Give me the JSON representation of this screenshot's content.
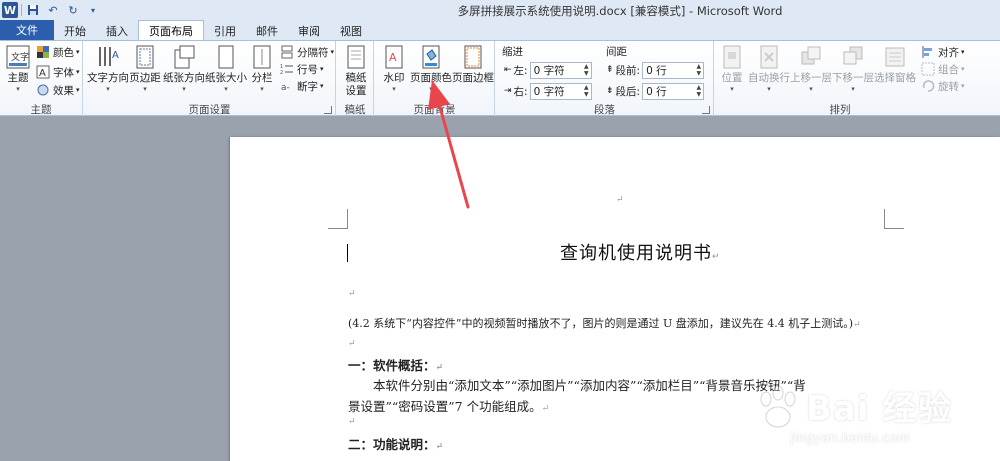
{
  "window": {
    "title": "多屏拼接展示系统使用说明.docx [兼容模式] - Microsoft Word",
    "app_icon": "W"
  },
  "tabs": [
    {
      "label": "文件"
    },
    {
      "label": "开始"
    },
    {
      "label": "插入"
    },
    {
      "label": "页面布局"
    },
    {
      "label": "引用"
    },
    {
      "label": "邮件"
    },
    {
      "label": "审阅"
    },
    {
      "label": "视图"
    }
  ],
  "ribbon": {
    "theme_group": {
      "label": "主题",
      "themes_btn": "主题",
      "colors": "颜色",
      "fonts": "字体",
      "effects": "效果"
    },
    "page_setup": {
      "label": "页面设置",
      "text_direction": "文字方向",
      "margins": "页边距",
      "orientation": "纸张方向",
      "size": "纸张大小",
      "columns": "分栏",
      "breaks": "分隔符",
      "line_numbers": "行号",
      "hyphenation": "断字"
    },
    "draft": {
      "label": "稿纸",
      "btn_line1": "稿纸",
      "btn_line2": "设置"
    },
    "background": {
      "label": "页面背景",
      "watermark": "水印",
      "page_color": "页面颜色",
      "page_borders": "页面边框"
    },
    "paragraph": {
      "label": "段落",
      "indent_title": "缩进",
      "spacing_title": "间距",
      "left_label": "左:",
      "left_value": "0 字符",
      "right_label": "右:",
      "right_value": "0 字符",
      "before_label": "段前:",
      "before_value": "0 行",
      "after_label": "段后:",
      "after_value": "0 行"
    },
    "arrange": {
      "label": "排列",
      "position": "位置",
      "wrap": "自动换行",
      "forward": "上移一层",
      "backward": "下移一层",
      "selection": "选择窗格",
      "align": "对齐",
      "group": "组合",
      "rotate": "旋转"
    }
  },
  "document": {
    "title": "查询机使用说明书",
    "note": "(4.2 系统下“内容控件”中的视频暂时播放不了，图片的则是通过 U 盘添加，建议先在 4.4 机子上测试。)",
    "heading1": "一：软件概括：",
    "body_line1": "本软件分别由“添加文本”“添加图片”“添加内容”“添加栏目”“背景音乐按钮”“背",
    "body_line2": "景设置”“密码设置”7 个功能组成。",
    "heading2": "二：功能说明：",
    "para_mark": "↵"
  },
  "watermark": {
    "text": "Bai 经验",
    "url": "jingyan.baidu.com"
  },
  "colors": {
    "file_tab": "#2b5fae",
    "arrow": "#e8464b"
  }
}
